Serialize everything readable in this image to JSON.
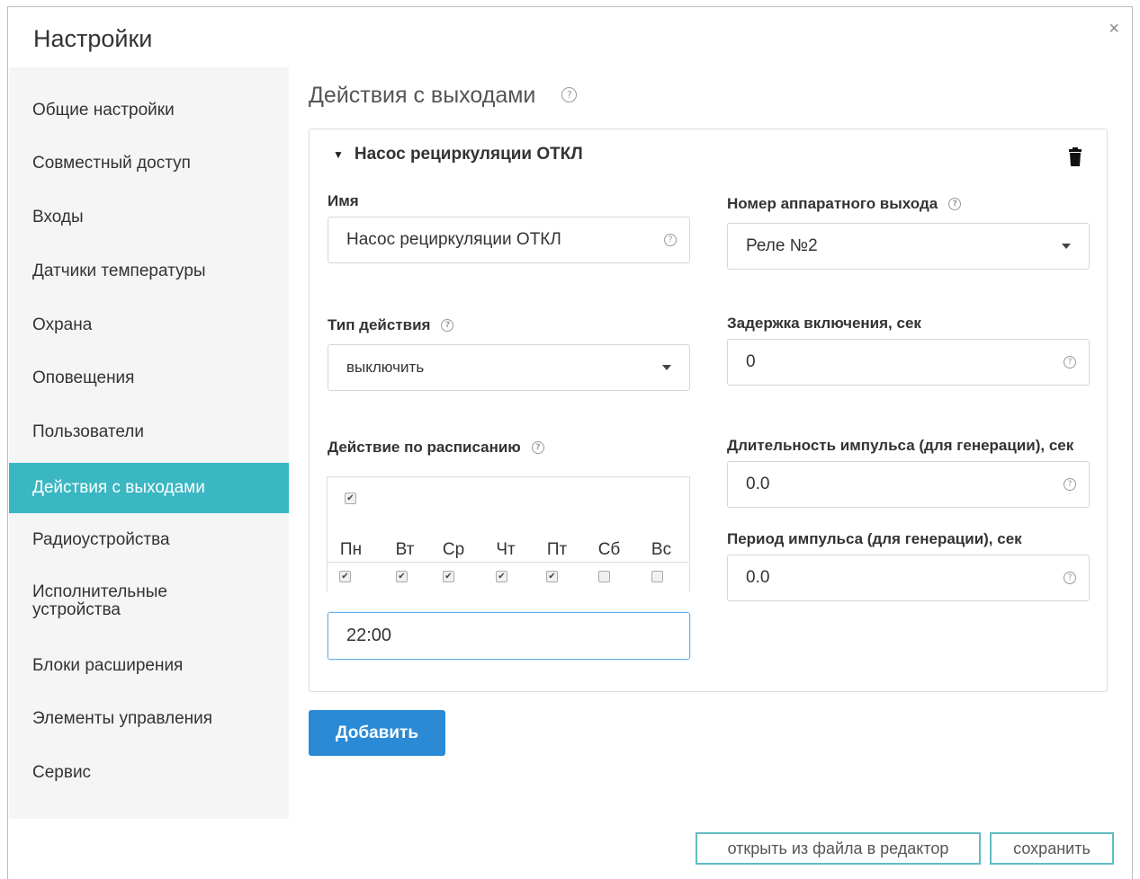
{
  "dialog": {
    "title": "Настройки",
    "close_glyph": "×"
  },
  "sidebar": {
    "items": [
      {
        "label": "Общие настройки"
      },
      {
        "label": "Совместный доступ"
      },
      {
        "label": "Входы"
      },
      {
        "label": "Датчики температуры"
      },
      {
        "label": "Охрана"
      },
      {
        "label": "Оповещения"
      },
      {
        "label": "Пользователи"
      },
      {
        "label": "Действия с выходами",
        "active": true
      },
      {
        "label": "Радиоустройства"
      },
      {
        "label": "Исполнительные устройства"
      },
      {
        "label": "Блоки расширения"
      },
      {
        "label": "Элементы управления"
      },
      {
        "label": "Сервис"
      }
    ],
    "active_color": "#3ab7c3"
  },
  "main": {
    "title": "Действия с выходами",
    "help_glyph": "?",
    "action": {
      "header": "Насос рециркуляции ОТКЛ",
      "name": {
        "label": "Имя",
        "value": "Насос рециркуляции ОТКЛ"
      },
      "hardware_output": {
        "label": "Номер аппаратного выхода",
        "value": "Реле №2"
      },
      "action_type": {
        "label": "Тип действия",
        "value": "выключить"
      },
      "delay": {
        "label": "Задержка включения, сек",
        "value": "0"
      },
      "schedule": {
        "label": "Действие по расписанию",
        "enabled": true,
        "days": [
          {
            "label": "Пн",
            "checked": true
          },
          {
            "label": "Вт",
            "checked": true
          },
          {
            "label": "Ср",
            "checked": true
          },
          {
            "label": "Чт",
            "checked": true
          },
          {
            "label": "Пт",
            "checked": true
          },
          {
            "label": "Сб",
            "checked": false
          },
          {
            "label": "Вс",
            "checked": false
          }
        ],
        "time": "22:00"
      },
      "pulse_duration": {
        "label": "Длительность импульса (для генерации), сек",
        "value": "0.0"
      },
      "pulse_period": {
        "label": "Период импульса (для генерации), сек",
        "value": "0.0"
      }
    },
    "add_button": "Добавить",
    "add_button_color": "#2b8ad6"
  },
  "footer": {
    "open_file_button": "открыть из файла в редактор",
    "save_button": "сохранить",
    "border_color": "#62bcc4"
  }
}
